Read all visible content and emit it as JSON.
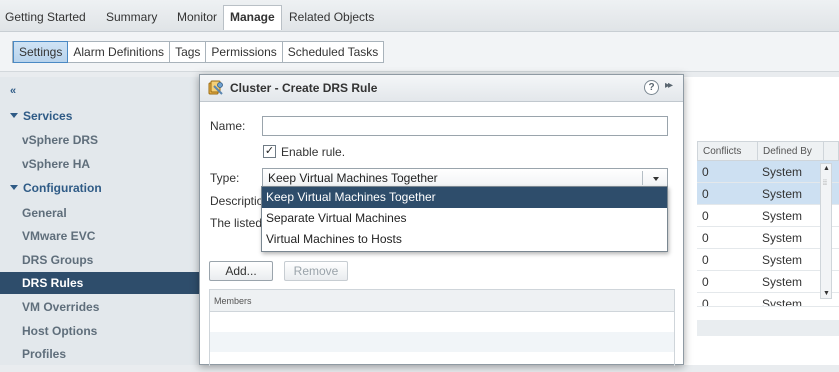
{
  "top_tabs": [
    {
      "label": "Getting Started"
    },
    {
      "label": "Summary"
    },
    {
      "label": "Monitor"
    },
    {
      "label": "Manage",
      "active": true
    },
    {
      "label": "Related Objects"
    }
  ],
  "sub_tabs": [
    {
      "label": "Settings",
      "active": true
    },
    {
      "label": "Alarm Definitions"
    },
    {
      "label": "Tags"
    },
    {
      "label": "Permissions"
    },
    {
      "label": "Scheduled Tasks"
    }
  ],
  "sidebar": {
    "collapse_glyph": "«",
    "services_heading": "Services",
    "services_items": [
      {
        "label": "vSphere DRS"
      },
      {
        "label": "vSphere HA"
      }
    ],
    "configuration_heading": "Configuration",
    "configuration_items": [
      {
        "label": "General"
      },
      {
        "label": "VMware EVC"
      },
      {
        "label": "DRS Groups"
      },
      {
        "label": "DRS Rules",
        "active": true
      },
      {
        "label": "VM Overrides"
      },
      {
        "label": "Host Options"
      },
      {
        "label": "Profiles"
      }
    ]
  },
  "background_table": {
    "headers": [
      "Conflicts",
      "Defined By"
    ],
    "rows": [
      {
        "conflicts": "0",
        "defined_by": "System",
        "selected": true
      },
      {
        "conflicts": "0",
        "defined_by": "System",
        "selected": true
      },
      {
        "conflicts": "0",
        "defined_by": "System"
      },
      {
        "conflicts": "0",
        "defined_by": "System"
      },
      {
        "conflicts": "0",
        "defined_by": "System"
      },
      {
        "conflicts": "0",
        "defined_by": "System"
      },
      {
        "conflicts": "0",
        "defined_by": "System"
      }
    ]
  },
  "dialog": {
    "title": "Cluster - Create DRS Rule",
    "help_glyph": "?",
    "expand_glyph": "▸▸",
    "name_label": "Name:",
    "name_value": "",
    "enable_label": "Enable rule.",
    "enable_checked": true,
    "check_glyph": "✓",
    "type_label": "Type:",
    "type_value": "Keep Virtual Machines Together",
    "description_label": "Descriptio",
    "listed_label": "The listed",
    "type_options": [
      {
        "label": "Keep Virtual Machines Together",
        "selected": true
      },
      {
        "label": "Separate Virtual Machines"
      },
      {
        "label": "Virtual Machines to Hosts"
      }
    ],
    "add_button": "Add...",
    "remove_button": "Remove",
    "members_header": "Members"
  },
  "colors": {
    "selection": "#2e4d6b",
    "tab_active": "#b8d3ec",
    "row_highlight": "#cde0f2"
  }
}
